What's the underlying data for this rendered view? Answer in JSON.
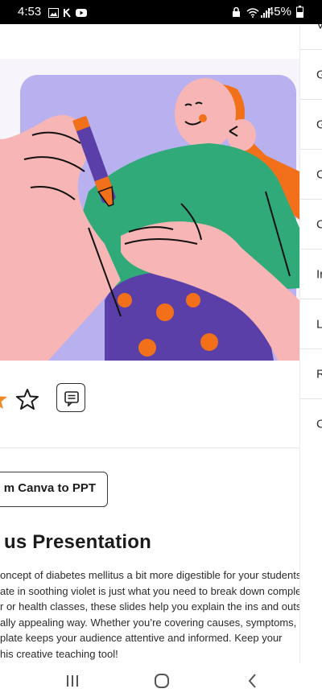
{
  "status_bar": {
    "time": "4:53",
    "battery_percent": "45%",
    "icons": [
      "gallery-icon",
      "k-app-icon",
      "youtube-icon",
      "lock-icon",
      "wifi-icon",
      "signal-icon",
      "battery-icon"
    ]
  },
  "toolbar": {
    "convert_label": "m Canva to PPT"
  },
  "main": {
    "title": "us Presentation",
    "description_lines": [
      "oncept of diabetes mellitus a bit more digestible for your students?",
      "ate in soothing violet is just what you need to break down complex",
      "r or health classes, these slides help you explain the ins and outs of",
      "ally appealing way. Whether you’re covering causes, symptoms, or",
      "plate keeps your audience attentive and informed. Keep your",
      "his creative teaching tool!"
    ]
  },
  "side_panel": {
    "items": [
      "V",
      "G",
      "G",
      "C",
      "C",
      "Ir",
      "L",
      "R",
      "C"
    ]
  },
  "colors": {
    "violet": "#b9b0f0",
    "green": "#2faa78",
    "skin": "#f7b5b5",
    "orange": "#f3701a",
    "purple": "#5b3fa8",
    "star_orange": "#f08a24"
  }
}
